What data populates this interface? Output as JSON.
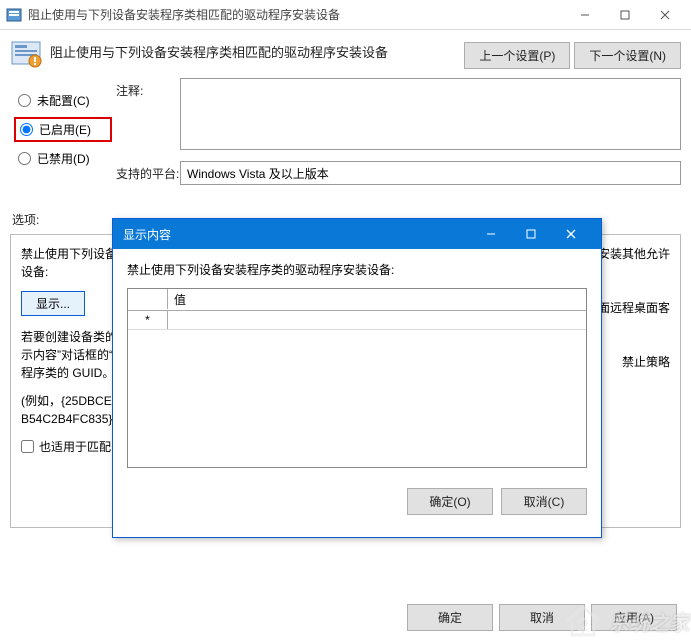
{
  "window": {
    "title": "阻止使用与下列设备安装程序类相匹配的驱动程序安装设备",
    "minimize_label": "Minimize",
    "maximize_label": "Maximize",
    "close_label": "Close"
  },
  "header": {
    "heading": "阻止使用与下列设备安装程序类相匹配的驱动程序安装设备",
    "prev_btn": "上一个设置(P)",
    "next_btn": "下一个设置(N)"
  },
  "radios": {
    "not_configured": "未配置(C)",
    "enabled": "已启用(E)",
    "disabled": "已禁用(D)",
    "selected": "enabled"
  },
  "fields": {
    "annotation_label": "注释:",
    "annotation_value": "",
    "platform_label": "支持的平台:",
    "platform_value": "Windows Vista 及以上版本"
  },
  "options": {
    "label": "选项:"
  },
  "left_panel": {
    "line1": "禁止使用下列设备安装程序类的驱动程序安装设备:",
    "show_btn": "显示...",
    "line2": "若要创建设备类的列表，请单击“显示”。在“显示内容”对话框的“值”列中，键入表示设备安装程序类的 GUID。",
    "line3": "(例如，{25DBCE51-6C8F-4A72-8A6D-B54C2B4FC835})。",
    "checkbox_label": "也适用于匹配已安装的设备。",
    "checkbox_checked": false
  },
  "right_panel": {
    "frag1": "的设备安装其他允许",
    "frag2": "的列表中远程桌面远程桌面客",
    "frag3": "禁止策略"
  },
  "footer": {
    "ok": "确定",
    "cancel": "取消",
    "apply": "应用(A)"
  },
  "modal": {
    "title": "显示内容",
    "desc": "禁止使用下列设备安装程序类的驱动程序安装设备:",
    "col_value": "值",
    "row1_marker": "*",
    "row1_value": "",
    "ok": "确定(O)",
    "cancel": "取消(C)"
  },
  "watermark": "系统之家"
}
